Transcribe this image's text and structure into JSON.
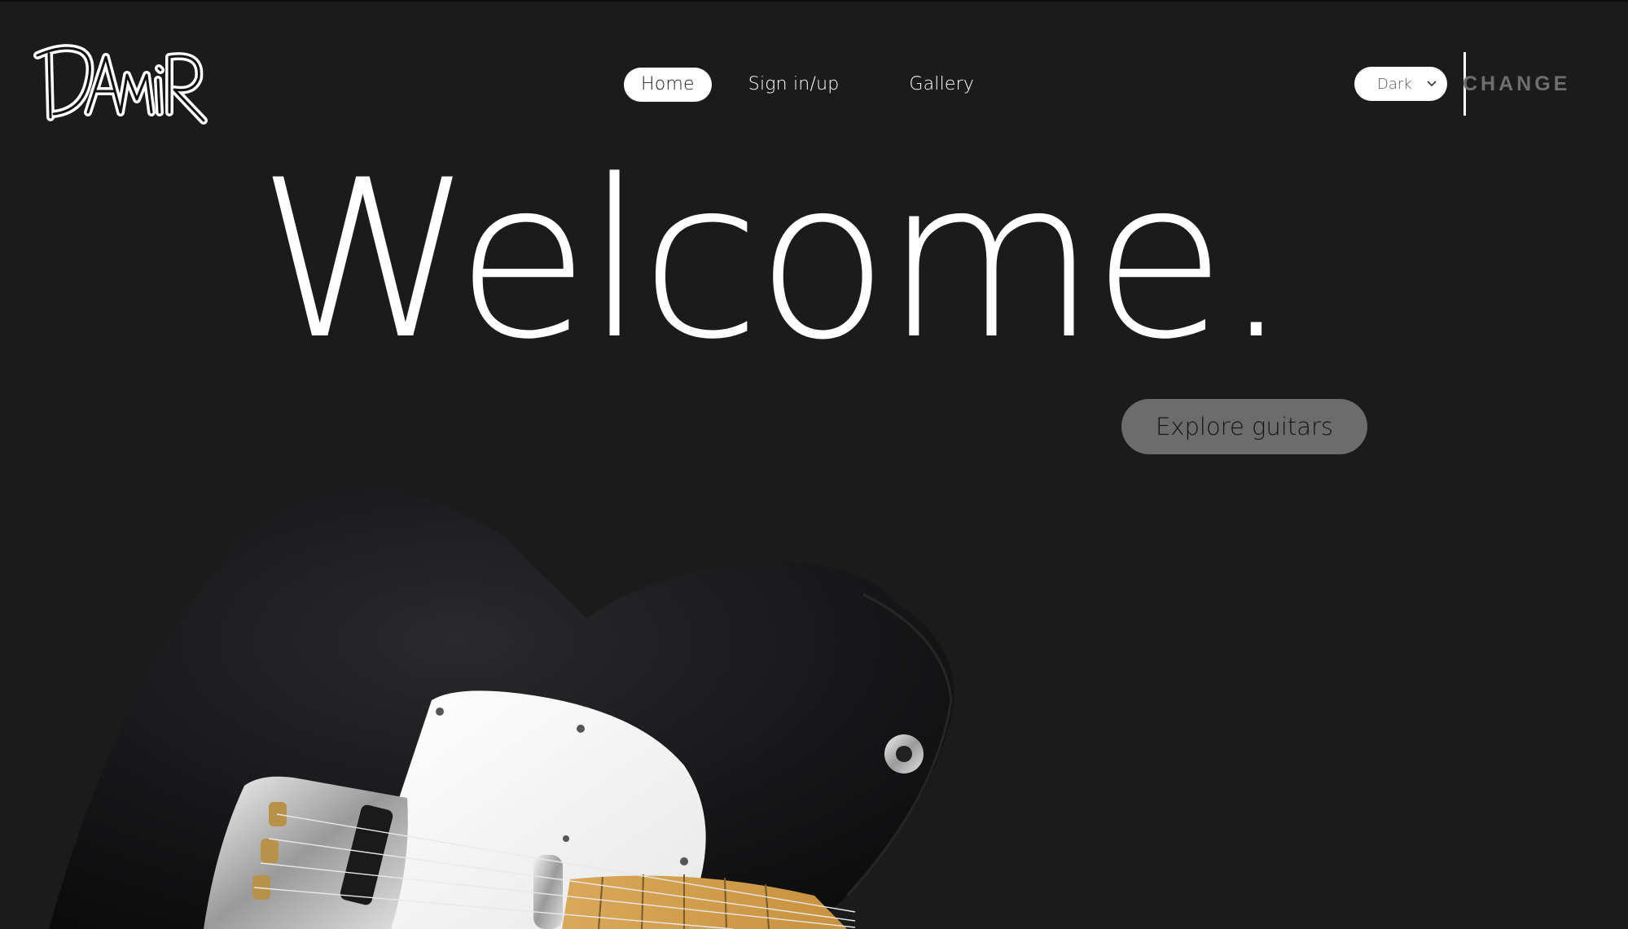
{
  "logo": {
    "text": "DAmiR"
  },
  "nav": {
    "items": [
      {
        "label": "Home",
        "active": true
      },
      {
        "label": "Sign in/up",
        "active": false
      },
      {
        "label": "Gallery",
        "active": false
      }
    ]
  },
  "theme": {
    "selected": "Dark",
    "change_label": "CHANGE"
  },
  "hero": {
    "title": "Welcome.",
    "cta_label": "Explore guitars"
  },
  "colors": {
    "background": "#1b1b1b",
    "accent": "#ffffff",
    "button_gray": "#6c6c6c"
  }
}
